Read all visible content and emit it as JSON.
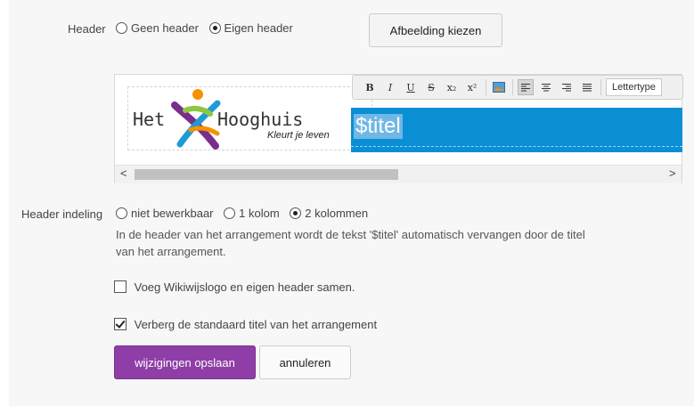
{
  "header": {
    "label": "Header",
    "options": [
      {
        "label": "Geen header",
        "checked": false
      },
      {
        "label": "Eigen header",
        "checked": true
      }
    ],
    "choose_image_button": "Afbeelding kiezen"
  },
  "editor": {
    "logo": {
      "text_left": "Het",
      "text_right": "Hooghuis",
      "tagline": "Kleurt je leven"
    },
    "title_placeholder": "$titel",
    "toolbar": {
      "bold": "B",
      "italic": "I",
      "underline": "U",
      "strike": "S",
      "subscript": "x₂",
      "superscript": "x²",
      "font_select": "Lettertype"
    },
    "scroll_left": "<",
    "scroll_right": ">"
  },
  "layout_section": {
    "label": "Header indeling",
    "options": [
      {
        "label": "niet bewerkbaar",
        "checked": false
      },
      {
        "label": "1 kolom",
        "checked": false
      },
      {
        "label": "2 kolommen",
        "checked": true
      }
    ],
    "help_line1": "In de header van het arrangement wordt de tekst '$titel' automatisch vervangen door de titel",
    "help_line2": "van het arrangement."
  },
  "checkboxes": [
    {
      "label": "Voeg Wikiwijslogo en eigen header samen.",
      "checked": false
    },
    {
      "label": "Verberg de standaard titel van het arrangement",
      "checked": true
    }
  ],
  "actions": {
    "save": "wijzigingen opslaan",
    "cancel": "annuleren"
  },
  "colors": {
    "primary": "#8e3ea6",
    "title_bg": "#0b8fd4",
    "logo_orange": "#f39200",
    "logo_purple": "#7b2d8b",
    "logo_green": "#8dc63f",
    "logo_blue": "#1e9ad6"
  }
}
